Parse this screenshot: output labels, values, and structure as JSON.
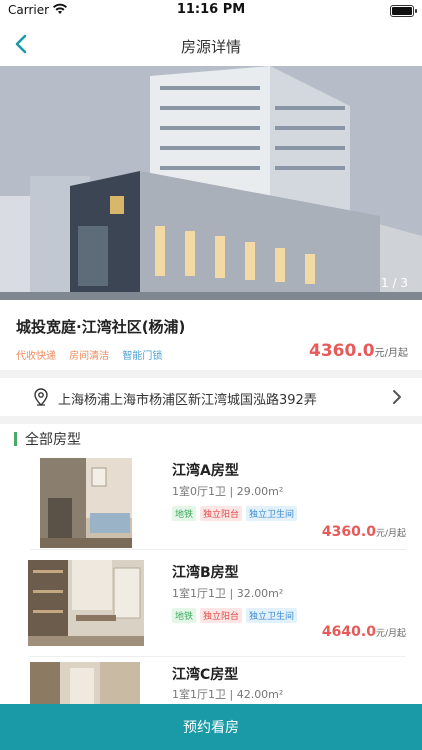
{
  "status_bar": {
    "carrier": "Carrier",
    "time": "11:16 PM"
  },
  "nav": {
    "title": "房源详情",
    "back_icon": "chevron-left-icon"
  },
  "hero": {
    "counter": "1 / 3"
  },
  "property": {
    "name": "城投宽庭·江湾社区(杨浦)",
    "tags": [
      {
        "label": "代收快递",
        "color": "#f08a5d"
      },
      {
        "label": "房间清洁",
        "color": "#f08a5d"
      },
      {
        "label": "智能门锁",
        "color": "#4a9fd8"
      }
    ],
    "price": "4360.0",
    "price_unit": "元/月起"
  },
  "address": {
    "text": "上海杨浦上海市杨浦区新江湾城国泓路392弄",
    "icon": "location-pin-icon"
  },
  "rooms_section": {
    "title": "全部房型"
  },
  "rooms": [
    {
      "name": "江湾A房型",
      "spec": "1室0厅1卫 | 29.00m²",
      "tags": [
        "地铁",
        "独立阳台",
        "独立卫生间"
      ],
      "price": "4360.0",
      "price_unit": "元/月起"
    },
    {
      "name": "江湾B房型",
      "spec": "1室1厅1卫 | 32.00m²",
      "tags": [
        "地铁",
        "独立阳台",
        "独立卫生间"
      ],
      "price": "4640.0",
      "price_unit": "元/月起"
    },
    {
      "name": "江湾C房型",
      "spec": "1室1厅1卫 | 42.00m²",
      "tags": [],
      "price": "",
      "price_unit": ""
    }
  ],
  "footer": {
    "book_label": "预约看房"
  },
  "colors": {
    "accent": "#1a9aa6",
    "price": "#e75a5a",
    "section_bar": "#48a96b"
  }
}
